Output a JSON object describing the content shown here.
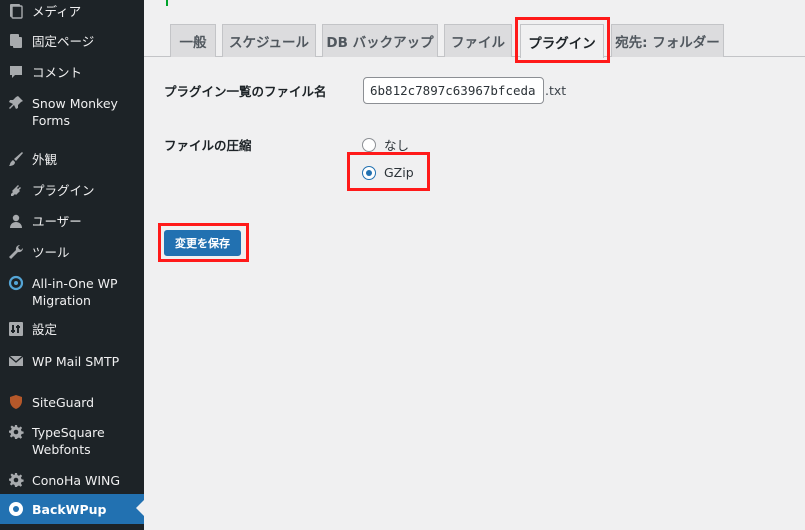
{
  "sidebar": {
    "items": [
      {
        "label": "メディア",
        "icon": "media-icon"
      },
      {
        "label": "固定ページ",
        "icon": "page-icon"
      },
      {
        "label": "コメント",
        "icon": "comment-icon"
      },
      {
        "label": "Snow Monkey Forms",
        "icon": "pin-icon"
      },
      {
        "label": "外観",
        "icon": "brush-icon"
      },
      {
        "label": "プラグイン",
        "icon": "plugin-icon"
      },
      {
        "label": "ユーザー",
        "icon": "user-icon"
      },
      {
        "label": "ツール",
        "icon": "wrench-icon"
      },
      {
        "label": "All-in-One WP Migration",
        "icon": "migration-icon"
      },
      {
        "label": "設定",
        "icon": "settings-icon"
      },
      {
        "label": "WP Mail SMTP",
        "icon": "mail-icon"
      },
      {
        "label": "SiteGuard",
        "icon": "shield-icon"
      },
      {
        "label": "TypeSquare Webfonts",
        "icon": "gear-icon"
      },
      {
        "label": "ConoHa WING",
        "icon": "gear-icon"
      },
      {
        "label": "BackWPup",
        "icon": "backwpup-icon"
      }
    ]
  },
  "tabs": [
    {
      "label": "一般"
    },
    {
      "label": "スケジュール"
    },
    {
      "label": "DB バックアップ"
    },
    {
      "label": "ファイル"
    },
    {
      "label": "プラグイン"
    },
    {
      "label": "宛先: フォルダー"
    }
  ],
  "form": {
    "filename_label": "プラグイン一覧のファイル名",
    "filename_value": "6b812c7897c63967bfceda",
    "filename_suffix": ".txt",
    "compression_label": "ファイルの圧縮",
    "compression_options": [
      "なし",
      "GZip"
    ],
    "compression_selected": "GZip"
  },
  "save_button": {
    "label": "変更を保存"
  },
  "colors": {
    "accent": "#2271b1",
    "highlight": "#ff1a1a",
    "sidebar": "#1d2327"
  }
}
